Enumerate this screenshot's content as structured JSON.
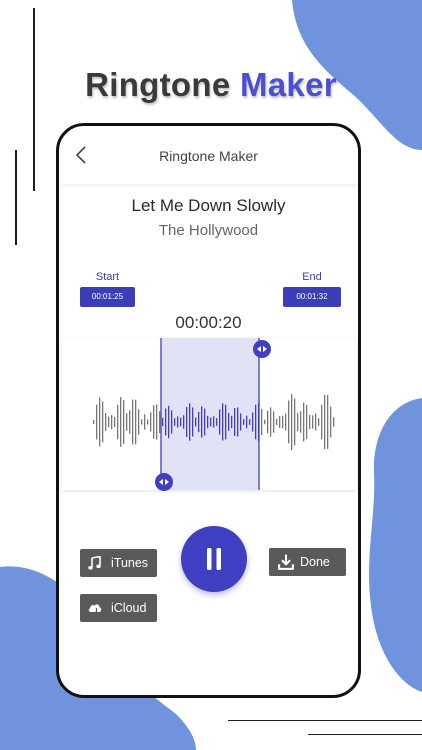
{
  "headline": {
    "word1": "Ringtone",
    "word2": "Maker"
  },
  "colors": {
    "accent": "#3f40c1",
    "blob": "#6f93dd",
    "selection": "#e1e2f6",
    "button_gray": "#5a5a5a"
  },
  "screen": {
    "title": "Ringtone Maker",
    "back_icon": "chevron-left-icon",
    "song": {
      "title": "Let Me Down Slowly",
      "artist": "The Hollywood"
    },
    "trim": {
      "start_label": "Start",
      "start_time": "00:01:25",
      "end_label": "End",
      "end_time": "00:01:32",
      "current_time": "00:00:20"
    },
    "player": {
      "state_icon": "pause-icon"
    },
    "actions": {
      "itunes": {
        "label": "iTunes",
        "icon": "music-note-icon"
      },
      "icloud": {
        "label": "iCloud",
        "icon": "cloud-music-icon"
      },
      "done": {
        "label": "Done",
        "icon": "download-icon"
      }
    }
  }
}
